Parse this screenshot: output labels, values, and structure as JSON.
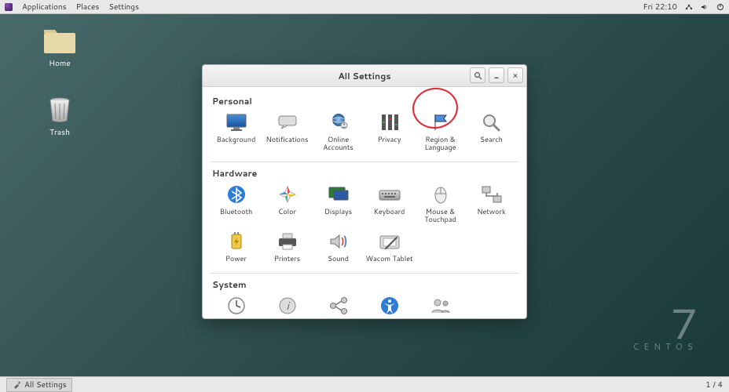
{
  "panel": {
    "menus": {
      "applications": "Applications",
      "places": "Places",
      "settings": "Settings"
    },
    "clock": "Fri 22:10"
  },
  "desktop": {
    "home": "Home",
    "trash": "Trash"
  },
  "branding": {
    "version": "7",
    "name": "CENTOS"
  },
  "taskbar": {
    "active": "All Settings",
    "workspaces": "1 / 4"
  },
  "window": {
    "title": "All Settings",
    "sections": {
      "personal": {
        "heading": "Personal",
        "items": {
          "background": "Background",
          "notifications": "Notifications",
          "online_accounts": "Online Accounts",
          "privacy": "Privacy",
          "region_language": "Region & Language",
          "search": "Search"
        }
      },
      "hardware": {
        "heading": "Hardware",
        "items": {
          "bluetooth": "Bluetooth",
          "color": "Color",
          "displays": "Displays",
          "keyboard": "Keyboard",
          "mouse_touchpad": "Mouse & Touchpad",
          "network": "Network",
          "power": "Power",
          "printers": "Printers",
          "sound": "Sound",
          "wacom": "Wacom Tablet"
        }
      },
      "system": {
        "heading": "System",
        "items": {
          "date_time": "Date & Time",
          "details": "Details",
          "sharing": "Sharing",
          "universal_access": "Universal Access",
          "users": "Users"
        }
      }
    }
  },
  "annotation": {
    "target": "region-language-cell"
  }
}
